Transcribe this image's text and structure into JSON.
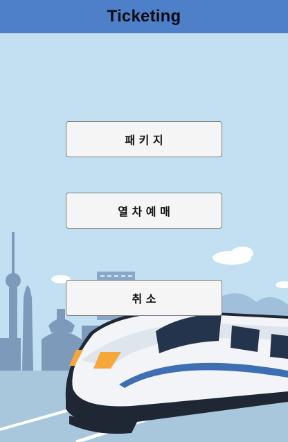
{
  "window": {
    "title": "Ticketing"
  },
  "menu": {
    "package_label": "패 키 지",
    "train_reservation_label": "열 차 예 매",
    "cancel_label": "취  소"
  },
  "colors": {
    "titlebar": "#4d80c9",
    "sky": "#c2e0f1",
    "button_bg": "#f5f5f5",
    "train_accent": "#f7a63a"
  }
}
